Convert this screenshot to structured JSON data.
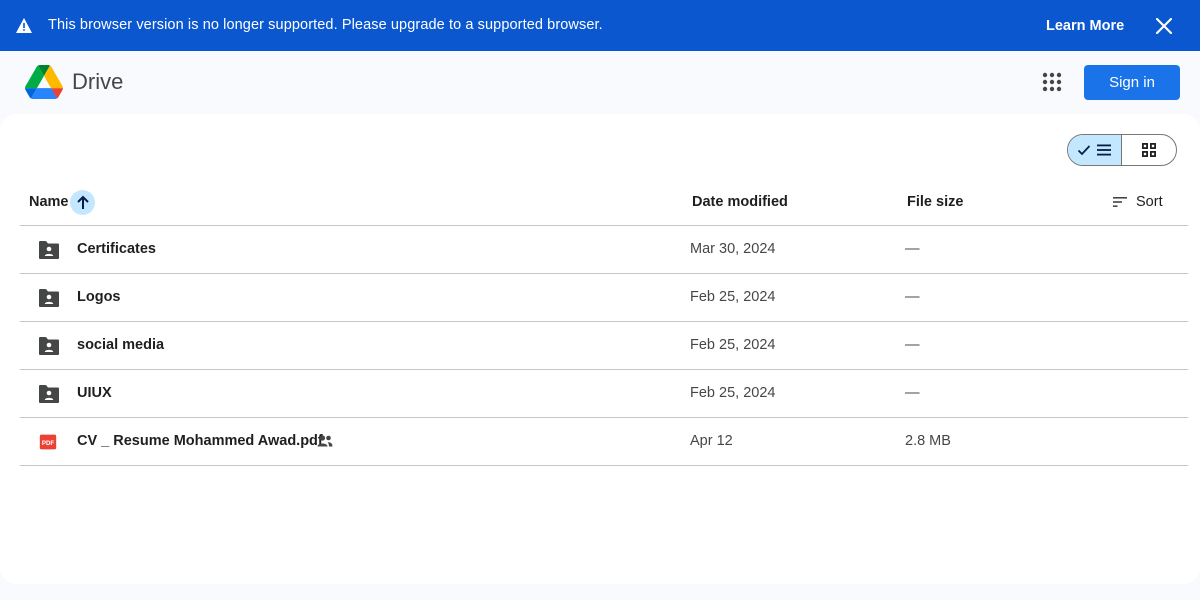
{
  "banner": {
    "message": "This browser version is no longer supported. Please upgrade to a supported browser.",
    "learn_more": "Learn More",
    "icons": {
      "warning": "warning-icon",
      "close": "close-icon"
    },
    "color": "#0b57d0"
  },
  "header": {
    "product_name": "Drive",
    "sign_in": "Sign in",
    "icons": {
      "logo": "google-drive-logo",
      "apps": "apps-grid-icon"
    },
    "accent": "#1a73e8"
  },
  "view_toggle": {
    "selected": "list",
    "options": [
      "list",
      "grid"
    ]
  },
  "table": {
    "columns": {
      "name": "Name",
      "date": "Date modified",
      "size": "File size",
      "sort": "Sort"
    },
    "sort_direction": "ascending",
    "rows": [
      {
        "name": "Certificates",
        "date": "Mar 30, 2024",
        "size": "—",
        "type": "shared-folder",
        "shared": false
      },
      {
        "name": "Logos",
        "date": "Feb 25, 2024",
        "size": "—",
        "type": "shared-folder",
        "shared": false
      },
      {
        "name": "social media",
        "date": "Feb 25, 2024",
        "size": "—",
        "type": "shared-folder",
        "shared": false
      },
      {
        "name": "UIUX",
        "date": "Feb 25, 2024",
        "size": "—",
        "type": "shared-folder",
        "shared": false
      },
      {
        "name": "CV _ Resume Mohammed Awad.pdf",
        "date": "Apr 12",
        "size": "2.8 MB",
        "type": "pdf",
        "shared": true
      }
    ]
  }
}
